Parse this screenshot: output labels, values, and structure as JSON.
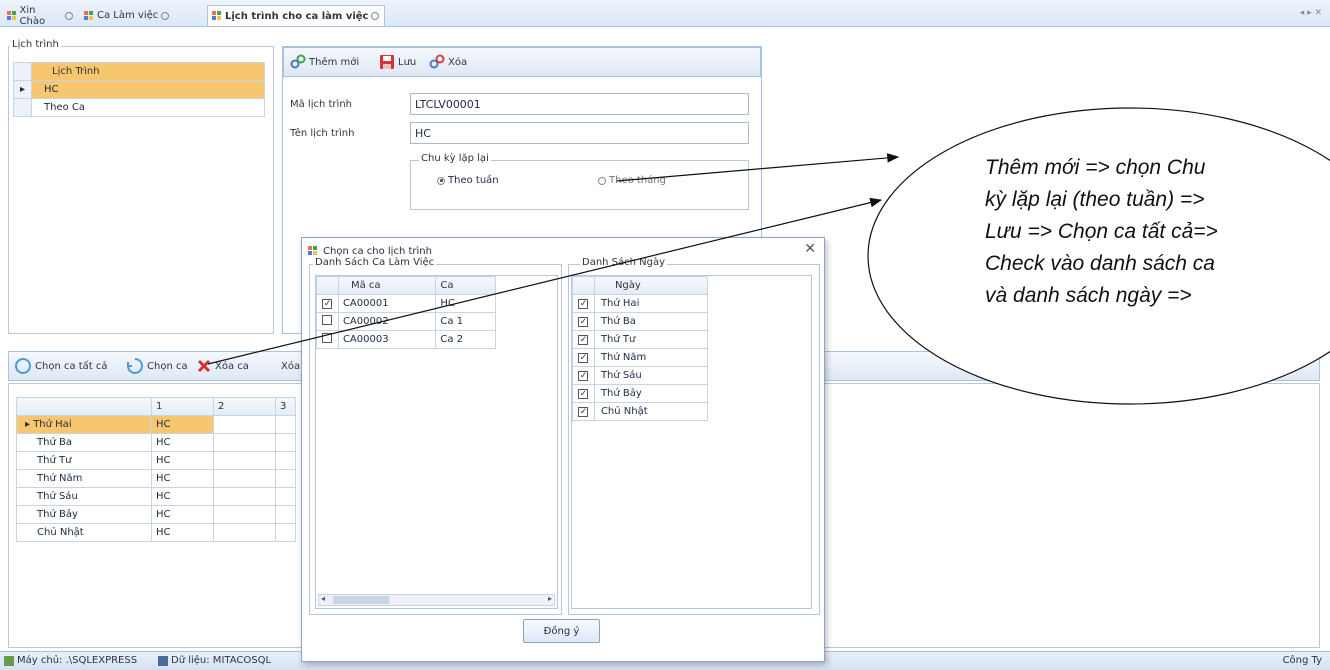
{
  "tabs": [
    {
      "label": "Xin Chào"
    },
    {
      "label": "Ca Làm việc"
    },
    {
      "label": "Lịch trình cho ca làm việc"
    }
  ],
  "tab_nav": "◂ ▸ ✕",
  "schedule_panel": {
    "group_title": "Lịch trình",
    "column_header": "Lịch Trình",
    "rows": [
      {
        "label": "HC",
        "selected": true
      },
      {
        "label": "Theo Ca",
        "selected": false
      }
    ]
  },
  "detail_toolbar": {
    "add_label": "Thêm mới",
    "save_label": "Lưu",
    "delete_label": "Xóa"
  },
  "detail_form": {
    "code_label": "Mã lịch trình",
    "code_value": "LTCLV00001",
    "name_label": "Tên lịch trình",
    "name_value": "HC",
    "repeat_group": "Chu kỳ lặp lại",
    "repeat_options": [
      {
        "label": "Theo tuần",
        "checked": true
      },
      {
        "label": "Theo tháng",
        "checked": false
      }
    ]
  },
  "bottom_toolbar": {
    "select_all_label": "Chọn ca tất cả",
    "select_label": "Chọn ca",
    "delete_label": "Xóa ca",
    "delete_all_label": "Xóa"
  },
  "bottom_grid": {
    "col_headers": [
      "1",
      "2",
      "3"
    ],
    "rows": [
      {
        "day": "Thứ Hai",
        "c1": "HC",
        "selected": true
      },
      {
        "day": "Thứ Ba",
        "c1": "HC"
      },
      {
        "day": "Thứ Tư",
        "c1": "HC"
      },
      {
        "day": "Thứ Năm",
        "c1": "HC"
      },
      {
        "day": "Thứ Sáu",
        "c1": "HC"
      },
      {
        "day": "Thứ Bảy",
        "c1": "HC"
      },
      {
        "day": "Chủ Nhật",
        "c1": "HC"
      }
    ]
  },
  "dialog": {
    "title": "Chọn ca cho lịch trình",
    "shifts_group": "Danh Sách Ca Làm Việc",
    "shift_headers": {
      "code": "Mã ca",
      "name": "Ca"
    },
    "shifts": [
      {
        "code": "CA00001",
        "name": "HC",
        "checked": true
      },
      {
        "code": "CA00002",
        "name": "Ca 1",
        "checked": false
      },
      {
        "code": "CA00003",
        "name": "Ca 2",
        "checked": false
      }
    ],
    "days_group": "Danh Sách Ngày",
    "day_header": "Ngày",
    "days": [
      {
        "label": "Thứ Hai",
        "checked": true
      },
      {
        "label": "Thứ Ba",
        "checked": true
      },
      {
        "label": "Thứ Tư",
        "checked": true
      },
      {
        "label": "Thứ Năm",
        "checked": true
      },
      {
        "label": "Thứ Sáu",
        "checked": true
      },
      {
        "label": "Thứ Bảy",
        "checked": true
      },
      {
        "label": "Chủ Nhật",
        "checked": true
      }
    ],
    "ok_label": "Đồng ý",
    "close_glyph": "✕"
  },
  "callout": {
    "lines": [
      "Thêm mới => chọn Chu",
      "kỳ lặp lại (theo tuần) =>",
      "Lưu => Chọn ca tất cả=>",
      "Check vào danh sách ca",
      "và danh sách ngày =>"
    ]
  },
  "statusbar": {
    "server": "Máy chủ: .\\SQLEXPRESS",
    "data": "Dữ liệu: MITACOSQL",
    "right": "Công Ty"
  },
  "colors": {
    "selection": "#f7c770",
    "border": "#a9c2e3",
    "toolbar_bg": "#dfe8f5"
  }
}
